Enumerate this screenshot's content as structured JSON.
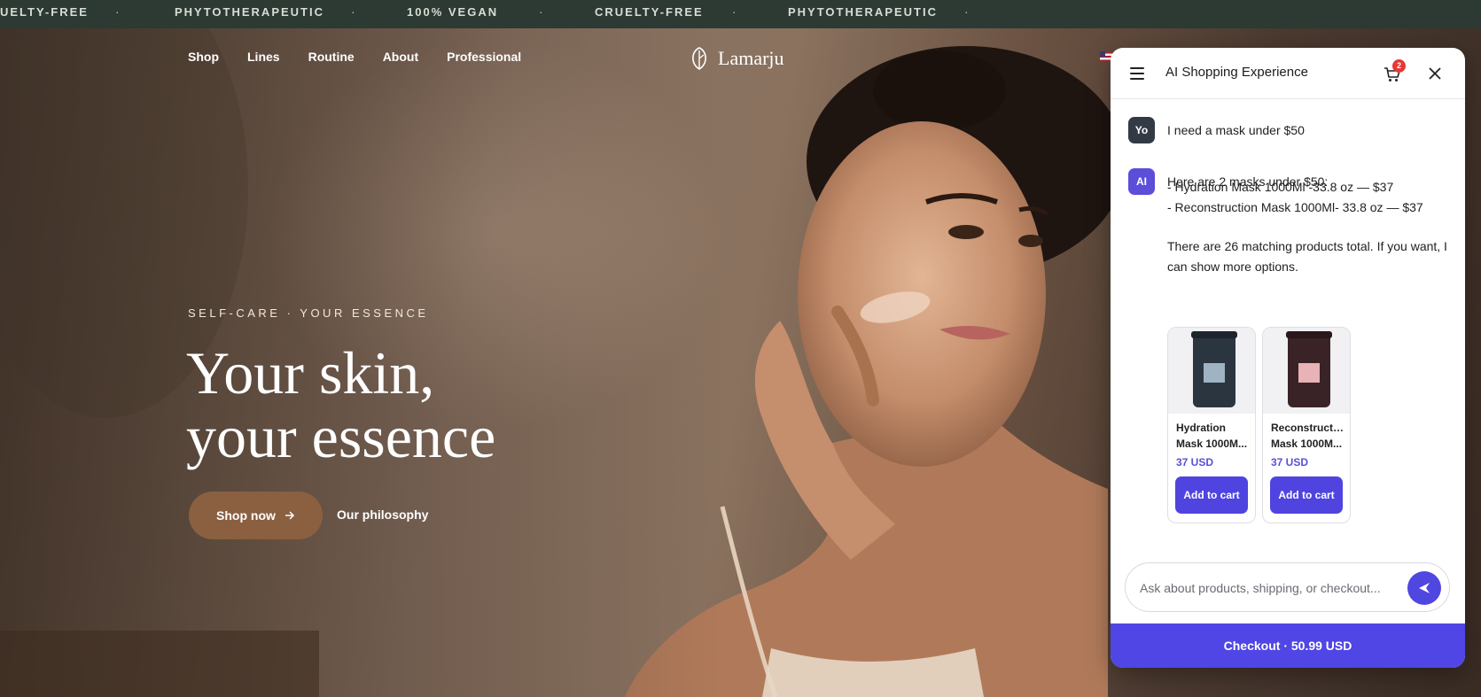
{
  "ticker": {
    "items": [
      "UELTY-FREE",
      "PHYTOTHERAPEUTIC",
      "100% VEGAN",
      "CRUELTY-FREE",
      "PHYTOTHERAPEUTIC"
    ],
    "separator": "·"
  },
  "nav": {
    "links": [
      "Shop",
      "Lines",
      "Routine",
      "About",
      "Professional"
    ],
    "logo": "Lamarju",
    "flag_icon": "us-flag-icon"
  },
  "hero": {
    "eyebrow": "SELF-CARE · YOUR ESSENCE",
    "headline_line1": "Your skin,",
    "headline_line2": "your essence",
    "primary_cta": "Shop now",
    "secondary_cta": "Our philosophy"
  },
  "chat": {
    "title": "AI Shopping Experience",
    "cart_count": "2",
    "user_avatar": "Yo",
    "user_message": "I need a mask under $50",
    "ai_avatar": "AI",
    "ai_intro": "Here are 2 masks under $50:",
    "ai_list": [
      "- Hydration Mask 1000Ml -33.8 oz — $37",
      "- Reconstruction Mask 1000Ml- 33.8 oz — $37"
    ],
    "ai_outro": "There are 26 matching products total. If you want, I can show more options.",
    "products": [
      {
        "name_line1": "Hydration",
        "name_line2": "Mask 1000M...",
        "price": "37 USD",
        "button": "Add to cart",
        "jar_color": "#2b3540",
        "label_tone": "#5a6f80"
      },
      {
        "name_line1": "Reconstruction",
        "name_line2": "Mask 1000M...",
        "price": "37 USD",
        "button": "Add to cart",
        "jar_color": "#3a2326",
        "label_tone": "#c87a80"
      }
    ],
    "input_placeholder": "Ask about products, shipping, or checkout...",
    "checkout": "Checkout · 50.99 USD",
    "accent": "#4f46e5"
  }
}
